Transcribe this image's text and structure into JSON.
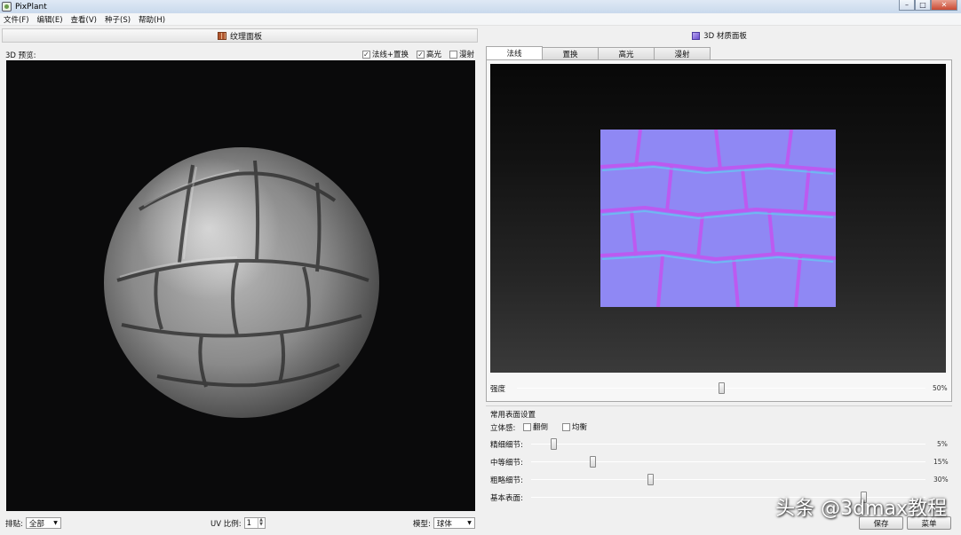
{
  "window": {
    "title": "PixPlant",
    "ghost_tabs": [
      "",
      "",
      ""
    ]
  },
  "menu": [
    "文件(F)",
    "编辑(E)",
    "查看(V)",
    "种子(S)",
    "帮助(H)"
  ],
  "left_panel": {
    "header": "纹理面板",
    "preview_label": "3D 预览:",
    "checks": [
      {
        "label": "法线+置换",
        "checked": true
      },
      {
        "label": "高光",
        "checked": true
      },
      {
        "label": "漫射",
        "checked": false
      }
    ],
    "tile_label": "排贴:",
    "tile_value": "全部",
    "uv_label": "UV 比例:",
    "uv_value": "1",
    "model_label": "模型:",
    "model_value": "球体"
  },
  "right_panel": {
    "header": "3D 材质面板",
    "tabs": [
      "法线",
      "置换",
      "高光",
      "漫射"
    ],
    "active_tab": "法线",
    "strength_label": "强度",
    "strength_value": "50%",
    "strength_level": 0.5,
    "group_title": "常用表面设置",
    "stereo_label": "立体感:",
    "invert_label": "翻倒",
    "balance_label": "均衡",
    "sliders": [
      {
        "label": "精细细节:",
        "value": "5%",
        "level": 0.05
      },
      {
        "label": "中等细节:",
        "value": "15%",
        "level": 0.15
      },
      {
        "label": "粗略细节:",
        "value": "30%",
        "level": 0.3
      },
      {
        "label": "基本表面:",
        "value": "",
        "level": 0.85
      }
    ],
    "save_button": "保存",
    "menu_button": "菜单"
  },
  "watermark": "头条 @3dmax教程"
}
